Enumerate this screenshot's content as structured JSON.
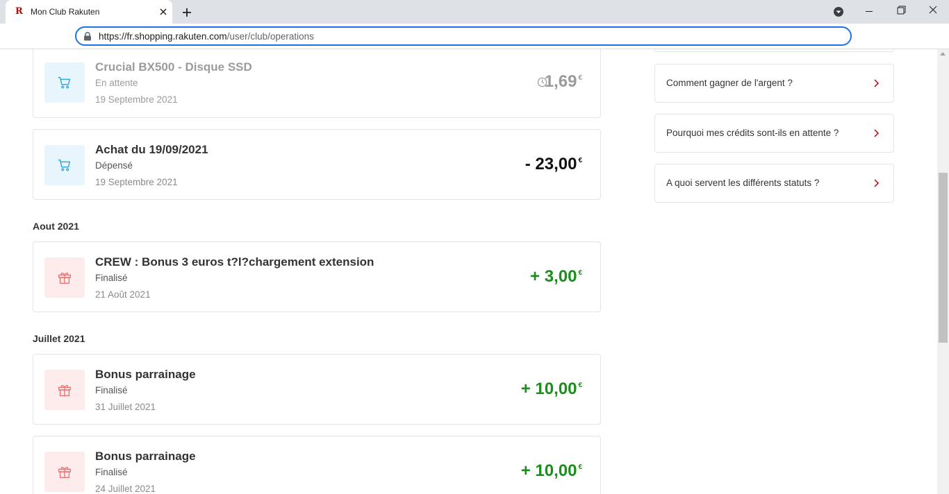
{
  "browser": {
    "tab_title": "Mon Club Rakuten",
    "favicon_letter": "R",
    "url_host": "https://fr.shopping.rakuten.com",
    "url_path": "/user/club/operations"
  },
  "colors": {
    "brand": "#bf0000",
    "credit": "#1b8e1b",
    "pending": "#9b9b9b",
    "accent_focus": "#1a73e8"
  },
  "operations": {
    "card1": {
      "title": "Crucial BX500 - Disque SSD",
      "status": "En attente",
      "date": "19 Septembre 2021",
      "amount": "1,69",
      "currency": "€",
      "icon": "cart-icon"
    },
    "card2": {
      "title": "Achat du 19/09/2021",
      "status": "Dépensé",
      "date": "19 Septembre 2021",
      "amount": "- 23,00",
      "currency": "€",
      "icon": "cart-icon"
    },
    "month_aout": "Aout 2021",
    "card3": {
      "title": "CREW : Bonus 3 euros t?l?chargement extension",
      "status": "Finalisé",
      "date": "21 Août 2021",
      "amount": "+ 3,00",
      "currency": "€",
      "icon": "gift-icon"
    },
    "month_juillet": "Juillet 2021",
    "card4": {
      "title": "Bonus parrainage",
      "status": "Finalisé",
      "date": "31 Juillet 2021",
      "amount": "+ 10,00",
      "currency": "€",
      "icon": "gift-icon"
    },
    "card5": {
      "title": "Bonus parrainage",
      "status": "Finalisé",
      "date": "24 Juillet 2021",
      "amount": "+ 10,00",
      "currency": "€",
      "icon": "gift-icon"
    }
  },
  "faq": {
    "item1": "Comment gagner de l'argent ?",
    "item2": "Pourquoi mes crédits sont-ils en attente ?",
    "item3": "A quoi servent les différents statuts ?"
  }
}
